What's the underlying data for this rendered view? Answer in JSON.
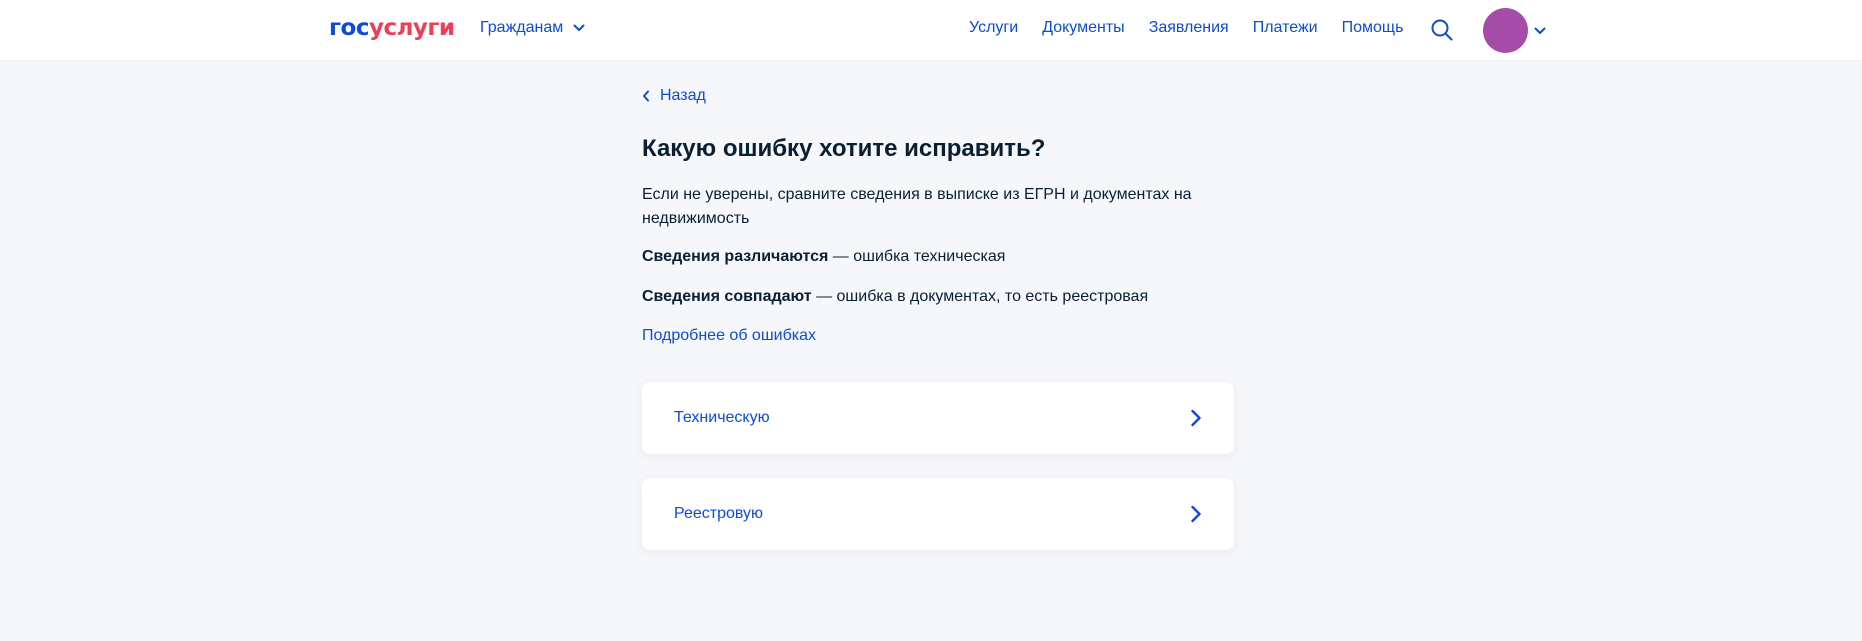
{
  "header": {
    "logo": {
      "part1": "гос",
      "part2": "услуги"
    },
    "audience": "Гражданам",
    "nav": [
      "Услуги",
      "Документы",
      "Заявления",
      "Платежи",
      "Помощь"
    ],
    "avatar_color": "#a54ba8"
  },
  "main": {
    "back_label": "Назад",
    "title": "Какую ошибку хотите исправить?",
    "description": "Если не уверены, сравните сведения в выписке из ЕГРН и документах на недвижимость",
    "rule1": {
      "bold": "Сведения различаются",
      "rest": " — ошибка техническая"
    },
    "rule2": {
      "bold": "Сведения совпадают",
      "rest": " — ошибка в документах, то есть реестровая"
    },
    "more_link": "Подробнее об ошибках",
    "options": [
      "Техническую",
      "Реестровую"
    ]
  },
  "colors": {
    "accent": "#0d4cd3",
    "brand_red": "#ee3f58",
    "background": "#f5f7fa",
    "text": "#0b1f33"
  }
}
